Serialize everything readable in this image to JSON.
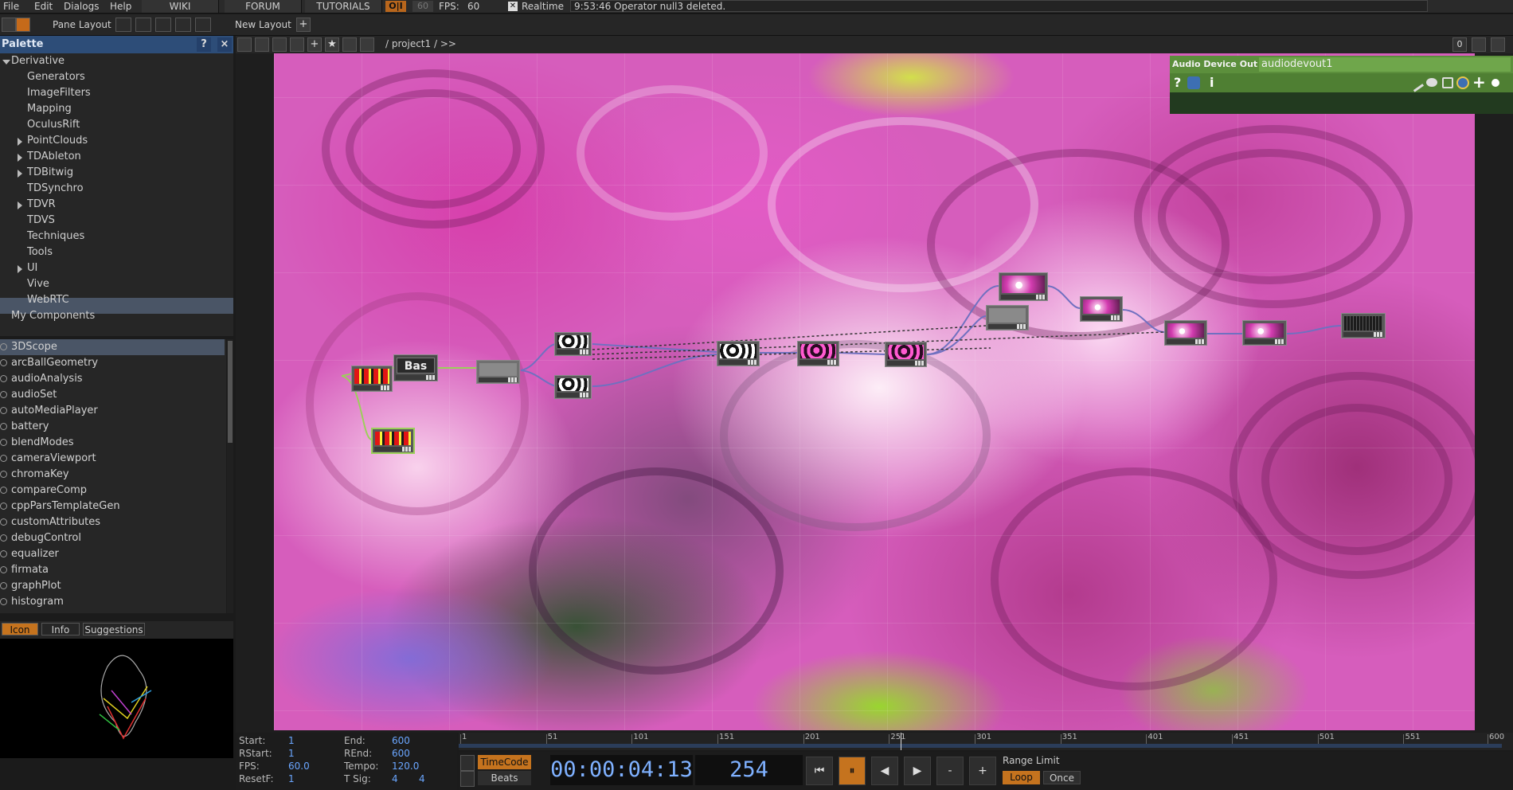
{
  "menubar": {
    "items": [
      "File",
      "Edit",
      "Dialogs",
      "Help"
    ],
    "tabs": [
      "WIKI",
      "FORUM",
      "TUTORIALS"
    ],
    "oi_badge": "O|I",
    "fps_badge": "60",
    "fps_label": "FPS:",
    "fps_value": "60",
    "realtime_label": "Realtime",
    "status_message": "9:53:46 Operator null3 deleted."
  },
  "toolbar": {
    "pane_layout_label": "Pane Layout",
    "new_layout_label": "New Layout",
    "plus": "+"
  },
  "palette": {
    "title": "Palette",
    "help": "?",
    "close": "×",
    "tree": [
      {
        "label": "Derivative",
        "expanded": true
      },
      {
        "label": "Generators"
      },
      {
        "label": "ImageFilters"
      },
      {
        "label": "Mapping"
      },
      {
        "label": "OculusRift"
      },
      {
        "label": "PointClouds",
        "expandable": true
      },
      {
        "label": "TDAbleton",
        "expandable": true
      },
      {
        "label": "TDBitwig",
        "expandable": true
      },
      {
        "label": "TDSynchro"
      },
      {
        "label": "TDVR",
        "expandable": true
      },
      {
        "label": "TDVS"
      },
      {
        "label": "Techniques"
      },
      {
        "label": "Tools",
        "selected": true
      },
      {
        "label": "UI",
        "expandable": true
      },
      {
        "label": "Vive"
      },
      {
        "label": "WebRTC"
      },
      {
        "label": "My Components"
      }
    ],
    "components": [
      "3DScope",
      "arcBallGeometry",
      "audioAnalysis",
      "audioSet",
      "autoMediaPlayer",
      "battery",
      "blendModes",
      "cameraViewport",
      "chromaKey",
      "compareComp",
      "cppParsTemplateGen",
      "customAttributes",
      "debugControl",
      "equalizer",
      "firmata",
      "graphPlot",
      "histogram"
    ],
    "tabs": {
      "icon": "Icon",
      "info": "Info",
      "suggestions": "Suggestions"
    }
  },
  "network": {
    "path": "/ project1 / >>",
    "counter": "0",
    "bas_label": "Bas"
  },
  "param_panel": {
    "op_type": "Audio Device Out",
    "op_name": "audiodevout1",
    "help": "?",
    "info": "i"
  },
  "timeline": {
    "start_label": "Start:",
    "start": "1",
    "end_label": "End:",
    "end": "600",
    "rstart_label": "RStart:",
    "rstart": "1",
    "rend_label": "REnd:",
    "rend": "600",
    "fps_label": "FPS:",
    "fps": "60.0",
    "tempo_label": "Tempo:",
    "tempo": "120.0",
    "resetf_label": "ResetF:",
    "resetf": "1",
    "tsig_label": "T Sig:",
    "tsig_a": "4",
    "tsig_b": "4",
    "ruler_labels": [
      "1",
      "51",
      "101",
      "151",
      "201",
      "251",
      "301",
      "351",
      "401",
      "451",
      "501",
      "551",
      "600"
    ],
    "timecode_btn": "TimeCode",
    "beats_btn": "Beats",
    "timecode": "00:00:04:13",
    "frame": "254",
    "range_limit_label": "Range Limit",
    "loop_btn": "Loop",
    "once_btn": "Once",
    "minus": "-",
    "plus": "+"
  },
  "colors": {
    "accent_orange": "#d88a2a",
    "palette_header": "#2d4d78",
    "param_header": "#5c8f3c",
    "timecode_text": "#7fb1ff"
  }
}
